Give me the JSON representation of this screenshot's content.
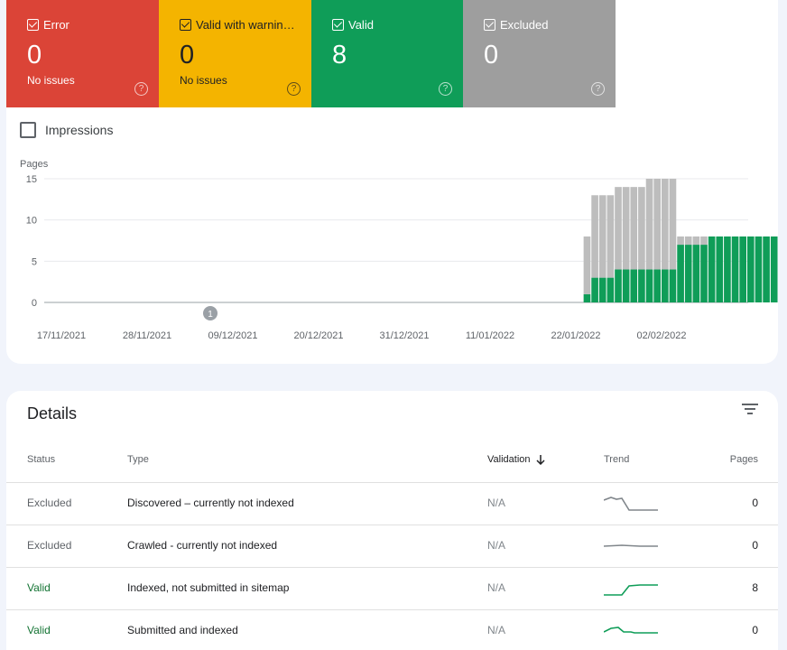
{
  "tiles": [
    {
      "name": "Error",
      "count": "0",
      "sub": "No issues",
      "help": "?"
    },
    {
      "name": "Valid with warnin…",
      "count": "0",
      "sub": "No issues",
      "help": "?"
    },
    {
      "name": "Valid",
      "count": "8",
      "sub": "",
      "help": "?"
    },
    {
      "name": "Excluded",
      "count": "0",
      "sub": "",
      "help": "?"
    }
  ],
  "impressions_label": "Impressions",
  "chart_data": {
    "type": "bar",
    "stacked": true,
    "ylabel": "Pages",
    "ylim": [
      0,
      15
    ],
    "yticks": [
      "0",
      "5",
      "10",
      "15"
    ],
    "xtick_labels": [
      "17/11/2021",
      "28/11/2021",
      "09/12/2021",
      "20/12/2021",
      "31/12/2021",
      "11/01/2022",
      "22/01/2022",
      "02/02/2022"
    ],
    "annotation": {
      "label": "1",
      "at": "09/12/2021"
    },
    "colors": {
      "valid": "#0f9d58",
      "excluded": "#bdbdbd"
    },
    "series": [
      {
        "name": "Valid",
        "values": [
          1,
          3,
          3,
          3,
          4,
          4,
          4,
          4,
          4,
          4,
          4,
          4,
          7,
          7,
          7,
          7,
          8,
          8,
          8,
          8,
          8,
          8,
          8,
          8,
          8,
          8,
          8,
          8,
          8,
          8,
          8,
          8,
          8
        ]
      },
      {
        "name": "Excluded",
        "values": [
          7,
          10,
          10,
          10,
          10,
          10,
          10,
          10,
          11,
          11,
          11,
          11,
          1,
          1,
          1,
          1,
          0,
          0,
          0,
          0,
          0,
          0,
          0,
          0,
          0,
          0,
          0,
          0,
          0,
          0,
          0,
          0,
          0
        ]
      }
    ],
    "start_day": 67
  },
  "details": {
    "title": "Details",
    "headers": {
      "status": "Status",
      "type": "Type",
      "validation": "Validation",
      "trend": "Trend",
      "pages": "Pages"
    },
    "rows": [
      {
        "status": "Excluded",
        "type": "Discovered – currently not indexed",
        "validation": "N/A",
        "pages": "0",
        "trend": "down",
        "color": "#80868b"
      },
      {
        "status": "Excluded",
        "type": "Crawled - currently not indexed",
        "validation": "N/A",
        "pages": "0",
        "trend": "flat",
        "color": "#80868b"
      },
      {
        "status": "Valid",
        "type": "Indexed, not submitted in sitemap",
        "validation": "N/A",
        "pages": "8",
        "trend": "up",
        "color": "#0f9d58"
      },
      {
        "status": "Valid",
        "type": "Submitted and indexed",
        "validation": "N/A",
        "pages": "0",
        "trend": "bump",
        "color": "#0f9d58"
      }
    ]
  }
}
